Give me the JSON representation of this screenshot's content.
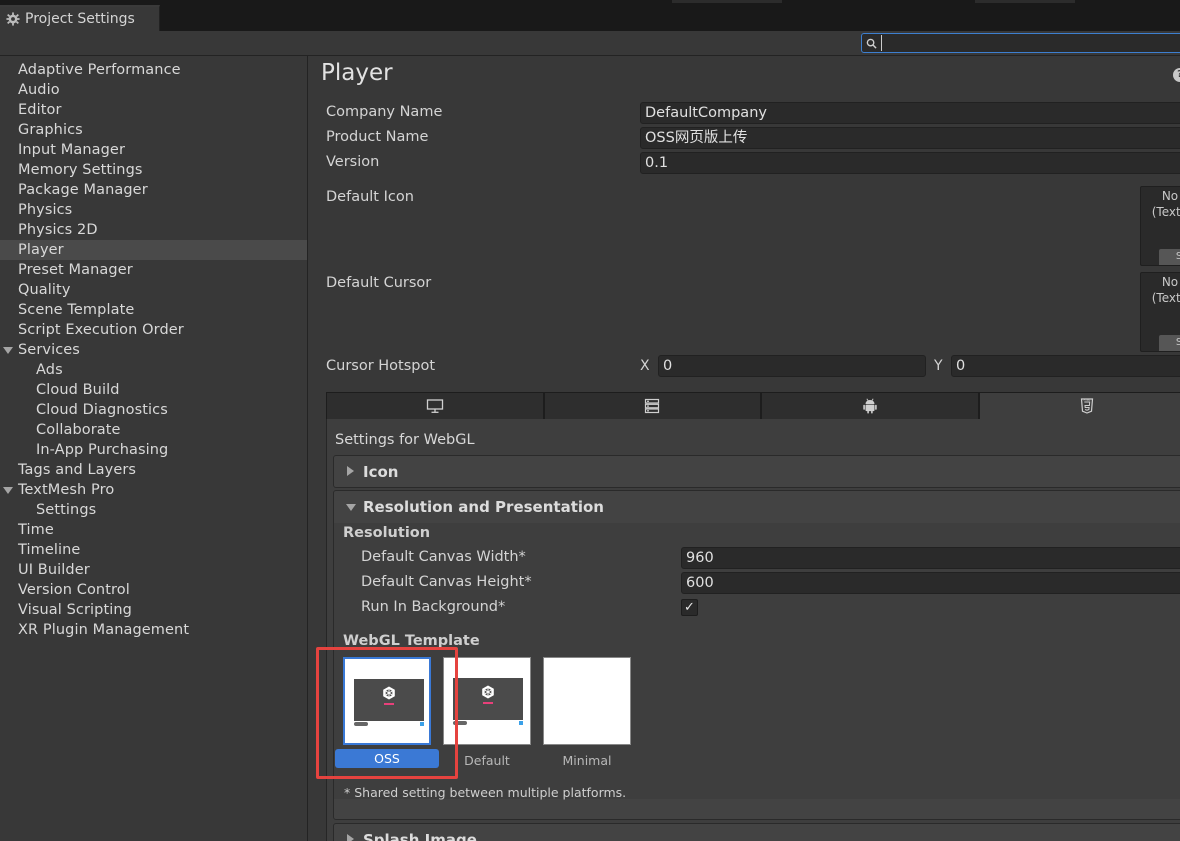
{
  "window": {
    "tab_title": "Project Settings"
  },
  "search": {
    "value": ""
  },
  "sidebar": {
    "items": [
      {
        "label": "Adaptive Performance"
      },
      {
        "label": "Audio"
      },
      {
        "label": "Editor"
      },
      {
        "label": "Graphics"
      },
      {
        "label": "Input Manager"
      },
      {
        "label": "Memory Settings"
      },
      {
        "label": "Package Manager"
      },
      {
        "label": "Physics"
      },
      {
        "label": "Physics 2D"
      },
      {
        "label": "Player"
      },
      {
        "label": "Preset Manager"
      },
      {
        "label": "Quality"
      },
      {
        "label": "Scene Template"
      },
      {
        "label": "Script Execution Order"
      },
      {
        "label": "Services"
      },
      {
        "label": "Ads"
      },
      {
        "label": "Cloud Build"
      },
      {
        "label": "Cloud Diagnostics"
      },
      {
        "label": "Collaborate"
      },
      {
        "label": "In-App Purchasing"
      },
      {
        "label": "Tags and Layers"
      },
      {
        "label": "TextMesh Pro"
      },
      {
        "label": "Settings"
      },
      {
        "label": "Time"
      },
      {
        "label": "Timeline"
      },
      {
        "label": "UI Builder"
      },
      {
        "label": "Version Control"
      },
      {
        "label": "Visual Scripting"
      },
      {
        "label": "XR Plugin Management"
      }
    ],
    "selected": "Player"
  },
  "player": {
    "title": "Player",
    "company_label": "Company Name",
    "company_value": "DefaultCompany",
    "product_label": "Product Name",
    "product_value": "OSS网页版上传",
    "version_label": "Version",
    "version_value": "0.1",
    "default_icon_label": "Default Icon",
    "default_cursor_label": "Default Cursor",
    "icon_slot_line1": "No",
    "icon_slot_line2": "(Textu",
    "icon_slot_select": "S",
    "cursor_hotspot_label": "Cursor Hotspot",
    "hotspot_x_label": "X",
    "hotspot_x_value": "0",
    "hotspot_y_label": "Y",
    "hotspot_y_value": "0"
  },
  "platform_tabs": [
    {
      "icon": "monitor-icon"
    },
    {
      "icon": "server-icon"
    },
    {
      "icon": "android-icon"
    },
    {
      "icon": "html5-icon",
      "active": true
    }
  ],
  "webgl": {
    "settings_for": "Settings for WebGL",
    "icon_section": "Icon",
    "resolution_section": "Resolution and Presentation",
    "resolution_sub": "Resolution",
    "canvas_width_label": "Default Canvas Width*",
    "canvas_width_value": "960",
    "canvas_height_label": "Default Canvas Height*",
    "canvas_height_value": "600",
    "run_bg_label": "Run In Background*",
    "run_bg_checked": "✓",
    "template_label": "WebGL Template",
    "templates": [
      {
        "name": "OSS",
        "selected": true
      },
      {
        "name": "Default"
      },
      {
        "name": "Minimal"
      }
    ],
    "shared_note": "* Shared setting between multiple platforms.",
    "splash_section": "Splash Image"
  },
  "colors": {
    "accent": "#3b79d5",
    "highlight_box": "#e5433f",
    "background": "#383838"
  }
}
